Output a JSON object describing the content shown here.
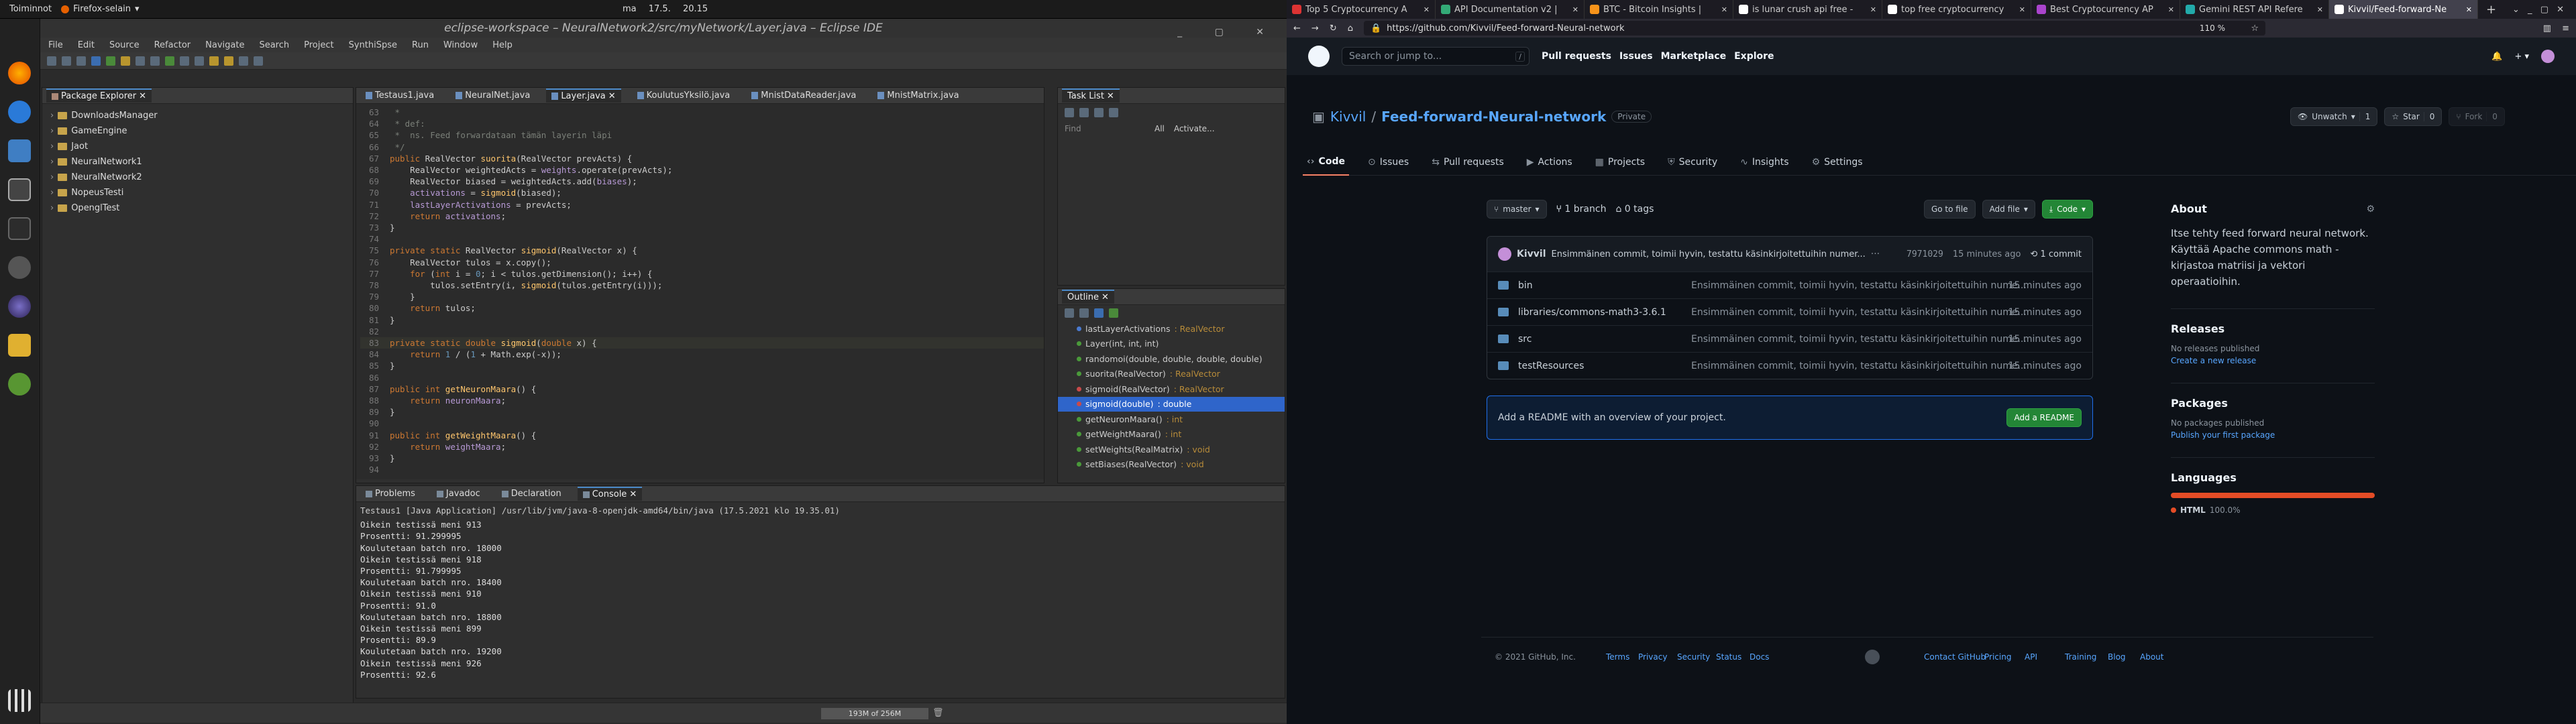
{
  "top_panel": {
    "activities": "Toiminnot",
    "app": "Firefox-selain",
    "clock": "ma 17.5. 20.15"
  },
  "eclipse": {
    "title": "eclipse-workspace – NeuralNetwork2/src/myNetwork/Layer.java – Eclipse IDE",
    "menu": [
      "File",
      "Edit",
      "Source",
      "Refactor",
      "Navigate",
      "Search",
      "Project",
      "SynthiSpse",
      "Run",
      "Window",
      "Help"
    ],
    "package_explorer": {
      "tab": "Package Explorer",
      "items": [
        "DownloadsManager",
        "GameEngine",
        "Jaot",
        "NeuralNetwork1",
        "NeuralNetwork2",
        "NopeusTesti",
        "OpenglTest"
      ]
    },
    "editor_tabs": [
      "Testaus1.java",
      "NeuralNet.java",
      "Layer.java",
      "KoulutusYksilö.java",
      "MnistDataReader.java",
      "MnistMatrix.java"
    ],
    "active_editor_tab": "Layer.java",
    "code": [
      {
        "n": "63",
        "t": " *"
      },
      {
        "n": "64",
        "t": " * def:"
      },
      {
        "n": "65",
        "t": " *  ns. Feed forwardataan tämän layerin läpi"
      },
      {
        "n": "66",
        "t": " */"
      },
      {
        "n": "67",
        "t": "public RealVector suorita(RealVector prevActs) {"
      },
      {
        "n": "68",
        "t": "    RealVector weightedActs = weights.operate(prevActs);"
      },
      {
        "n": "69",
        "t": "    RealVector biased = weightedActs.add(biases);"
      },
      {
        "n": "70",
        "t": "    activations = sigmoid(biased);"
      },
      {
        "n": "71",
        "t": "    lastLayerActivations = prevActs;"
      },
      {
        "n": "72",
        "t": "    return activations;"
      },
      {
        "n": "73",
        "t": "}"
      },
      {
        "n": "74",
        "t": ""
      },
      {
        "n": "75",
        "t": "private static RealVector sigmoid(RealVector x) {"
      },
      {
        "n": "76",
        "t": "    RealVector tulos = x.copy();"
      },
      {
        "n": "77",
        "t": "    for (int i = 0; i < tulos.getDimension(); i++) {"
      },
      {
        "n": "78",
        "t": "        tulos.setEntry(i, sigmoid(tulos.getEntry(i)));"
      },
      {
        "n": "79",
        "t": "    }"
      },
      {
        "n": "80",
        "t": "    return tulos;"
      },
      {
        "n": "81",
        "t": "}"
      },
      {
        "n": "82",
        "t": ""
      },
      {
        "n": "83",
        "t": "private static double sigmoid(double x) {"
      },
      {
        "n": "84",
        "t": "    return 1 / (1 + Math.exp(-x));"
      },
      {
        "n": "85",
        "t": "}"
      },
      {
        "n": "86",
        "t": ""
      },
      {
        "n": "87",
        "t": "public int getNeuronMaara() {"
      },
      {
        "n": "88",
        "t": "    return neuronMaara;"
      },
      {
        "n": "89",
        "t": "}"
      },
      {
        "n": "90",
        "t": ""
      },
      {
        "n": "91",
        "t": "public int getWeightMaara() {"
      },
      {
        "n": "92",
        "t": "    return weightMaara;"
      },
      {
        "n": "93",
        "t": "}"
      },
      {
        "n": "94",
        "t": ""
      }
    ],
    "task_list": {
      "tab": "Task List",
      "find_placeholder": "Find",
      "all": "All",
      "activate": "Activate..."
    },
    "outline": {
      "tab": "Outline",
      "items": [
        {
          "name": "lastLayerActivations",
          "type": ": RealVector",
          "vis": "field"
        },
        {
          "name": "Layer(int, int, int)",
          "type": "",
          "vis": "public"
        },
        {
          "name": "randomoi(double, double, double, double)",
          "type": "",
          "vis": "public"
        },
        {
          "name": "suorita(RealVector)",
          "type": ": RealVector",
          "vis": "public"
        },
        {
          "name": "sigmoid(RealVector)",
          "type": ": RealVector",
          "vis": "private"
        },
        {
          "name": "sigmoid(double)",
          "type": ": double",
          "vis": "private",
          "selected": true
        },
        {
          "name": "getNeuronMaara()",
          "type": ": int",
          "vis": "public"
        },
        {
          "name": "getWeightMaara()",
          "type": ": int",
          "vis": "public"
        },
        {
          "name": "setWeights(RealMatrix)",
          "type": ": void",
          "vis": "public"
        },
        {
          "name": "setBiases(RealVector)",
          "type": ": void",
          "vis": "public"
        }
      ]
    },
    "bottom_tabs": [
      "Problems",
      "Javadoc",
      "Declaration",
      "Console"
    ],
    "console_header": "Testaus1 [Java Application] /usr/lib/jvm/java-8-openjdk-amd64/bin/java (17.5.2021 klo 19.35.01)",
    "console": [
      "Oikein testissä meni 913",
      "Prosentti: 91.299995",
      "Koulutetaan batch nro. 18000",
      "Oikein testissä meni 918",
      "Prosentti: 91.799995",
      "Koulutetaan batch nro. 18400",
      "Oikein testissä meni 910",
      "Prosentti: 91.0",
      "Koulutetaan batch nro. 18800",
      "Oikein testissä meni 899",
      "Prosentti: 89.9",
      "Koulutetaan batch nro. 19200",
      "Oikein testissä meni 926",
      "Prosentti: 92.6"
    ],
    "heap": "193M of 256M"
  },
  "firefox": {
    "tabs": [
      {
        "title": "Top 5 Cryptocurrency A",
        "fav": "#d33"
      },
      {
        "title": "API Documentation v2 |",
        "fav": "#3a7"
      },
      {
        "title": "BTC - Bitcoin Insights |",
        "fav": "#f7931a"
      },
      {
        "title": "is lunar crush api free -",
        "fav": "#fff"
      },
      {
        "title": "top free cryptocurrency",
        "fav": "#fff"
      },
      {
        "title": "Best Cryptocurrency AP",
        "fav": "#a4c"
      },
      {
        "title": "Gemini REST API Refere",
        "fav": "#2aa"
      },
      {
        "title": "Kivvil/Feed-forward-Ne",
        "fav": "#fff",
        "active": true
      }
    ],
    "url": "https://github.com/Kivvil/Feed-forward-Neural-network",
    "zoom": "110 %"
  },
  "github": {
    "search_placeholder": "Search or jump to...",
    "nav": [
      "Pull requests",
      "Issues",
      "Marketplace",
      "Explore"
    ],
    "owner": "Kivvil",
    "repo": "Feed-forward-Neural-network",
    "visibility": "Private",
    "unwatch": "Unwatch",
    "unwatch_count": "1",
    "star": "Star",
    "star_count": "0",
    "fork": "Fork",
    "fork_count": "0",
    "tabs": [
      "Code",
      "Issues",
      "Pull requests",
      "Actions",
      "Projects",
      "Security",
      "Insights",
      "Settings"
    ],
    "branch": "master",
    "branches": "1 branch",
    "tags": "0 tags",
    "go_to_file": "Go to file",
    "add_file": "Add file",
    "code_btn": "Code",
    "commit": {
      "author": "Kivvil",
      "message": "Ensimmäinen commit, toimii hyvin, testattu käsinkirjoitettuihin numer...",
      "hash": "7971029",
      "time": "15 minutes ago",
      "count": "1 commit"
    },
    "files": [
      {
        "name": "bin",
        "msg": "Ensimmäinen commit, toimii hyvin, testattu käsinkirjoitettuihin nume...",
        "time": "15 minutes ago"
      },
      {
        "name": "libraries/commons-math3-3.6.1",
        "msg": "Ensimmäinen commit, toimii hyvin, testattu käsinkirjoitettuihin nume...",
        "time": "15 minutes ago"
      },
      {
        "name": "src",
        "msg": "Ensimmäinen commit, toimii hyvin, testattu käsinkirjoitettuihin nume...",
        "time": "15 minutes ago"
      },
      {
        "name": "testResources",
        "msg": "Ensimmäinen commit, toimii hyvin, testattu käsinkirjoitettuihin nume...",
        "time": "15 minutes ago"
      }
    ],
    "readme_prompt": "Add a README with an overview of your project.",
    "readme_btn": "Add a README",
    "about": {
      "title": "About",
      "text": "Itse tehty feed forward neural network. Käyttää Apache commons math -kirjastoa matriisi ja vektori operaatioihin."
    },
    "releases": {
      "title": "Releases",
      "none": "No releases published",
      "link": "Create a new release"
    },
    "packages": {
      "title": "Packages",
      "none": "No packages published",
      "link": "Publish your first package"
    },
    "languages": {
      "title": "Languages",
      "name": "HTML",
      "pct": "100.0%",
      "color": "#e34c26"
    },
    "footer": [
      "© 2021 GitHub, Inc.",
      "Terms",
      "Privacy",
      "Security",
      "Status",
      "Docs",
      "Contact GitHub",
      "Pricing",
      "API",
      "Training",
      "Blog",
      "About"
    ]
  }
}
